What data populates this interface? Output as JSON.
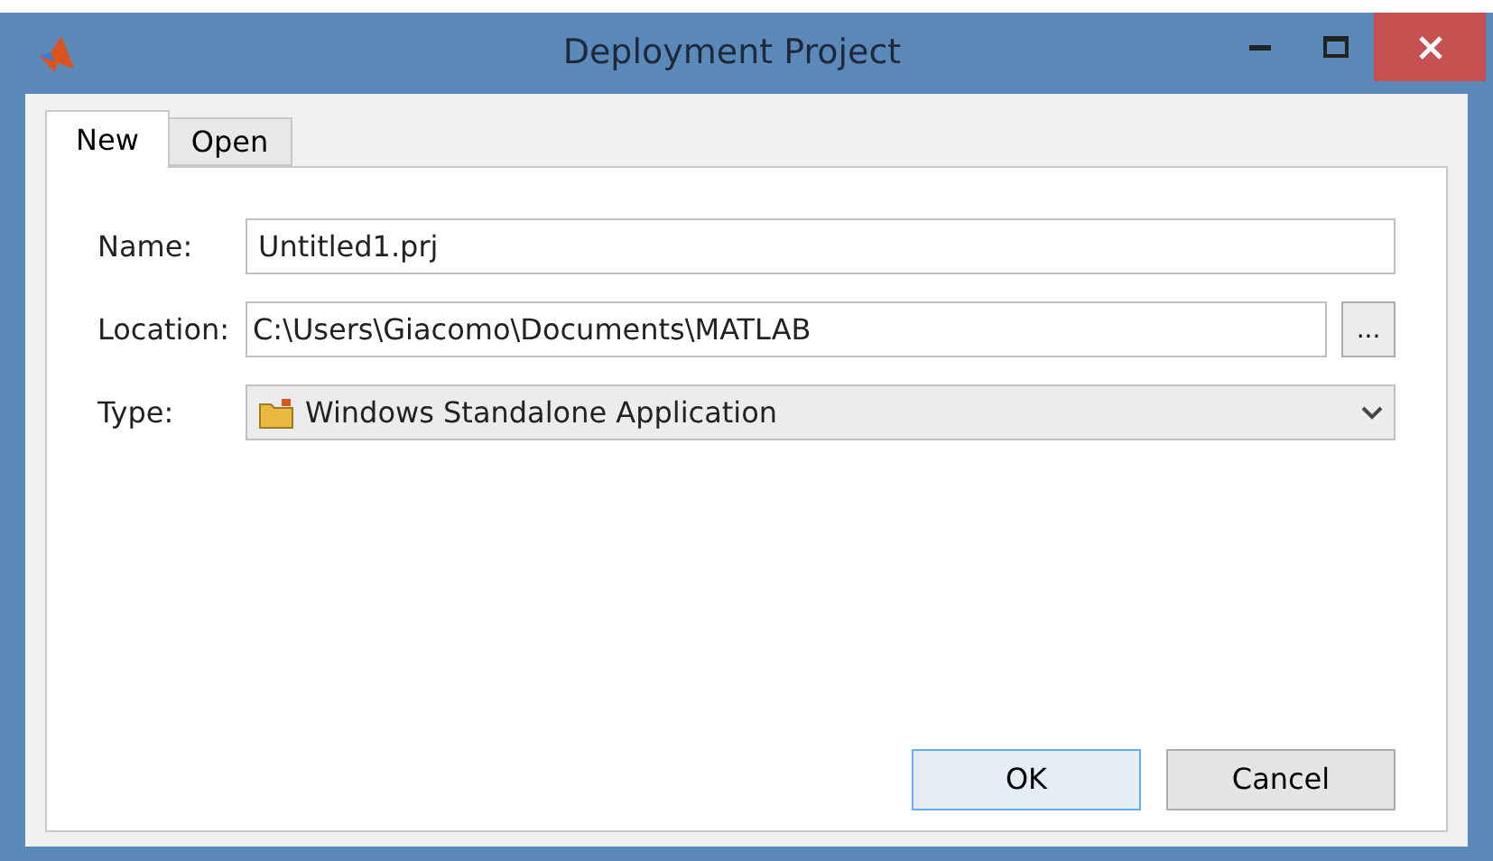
{
  "window": {
    "title": "Deployment Project"
  },
  "tabs": [
    {
      "label": "New",
      "selected": true
    },
    {
      "label": "Open",
      "selected": false
    }
  ],
  "form": {
    "name": {
      "label": "Name:",
      "value": "Untitled1.prj"
    },
    "location": {
      "label": "Location:",
      "value": "C:\\Users\\Giacomo\\Documents\\MATLAB",
      "browse": "..."
    },
    "type": {
      "label": "Type:",
      "value": "Windows Standalone Application"
    }
  },
  "buttons": [
    {
      "label": "OK",
      "default": true
    },
    {
      "label": "Cancel",
      "default": false
    }
  ]
}
